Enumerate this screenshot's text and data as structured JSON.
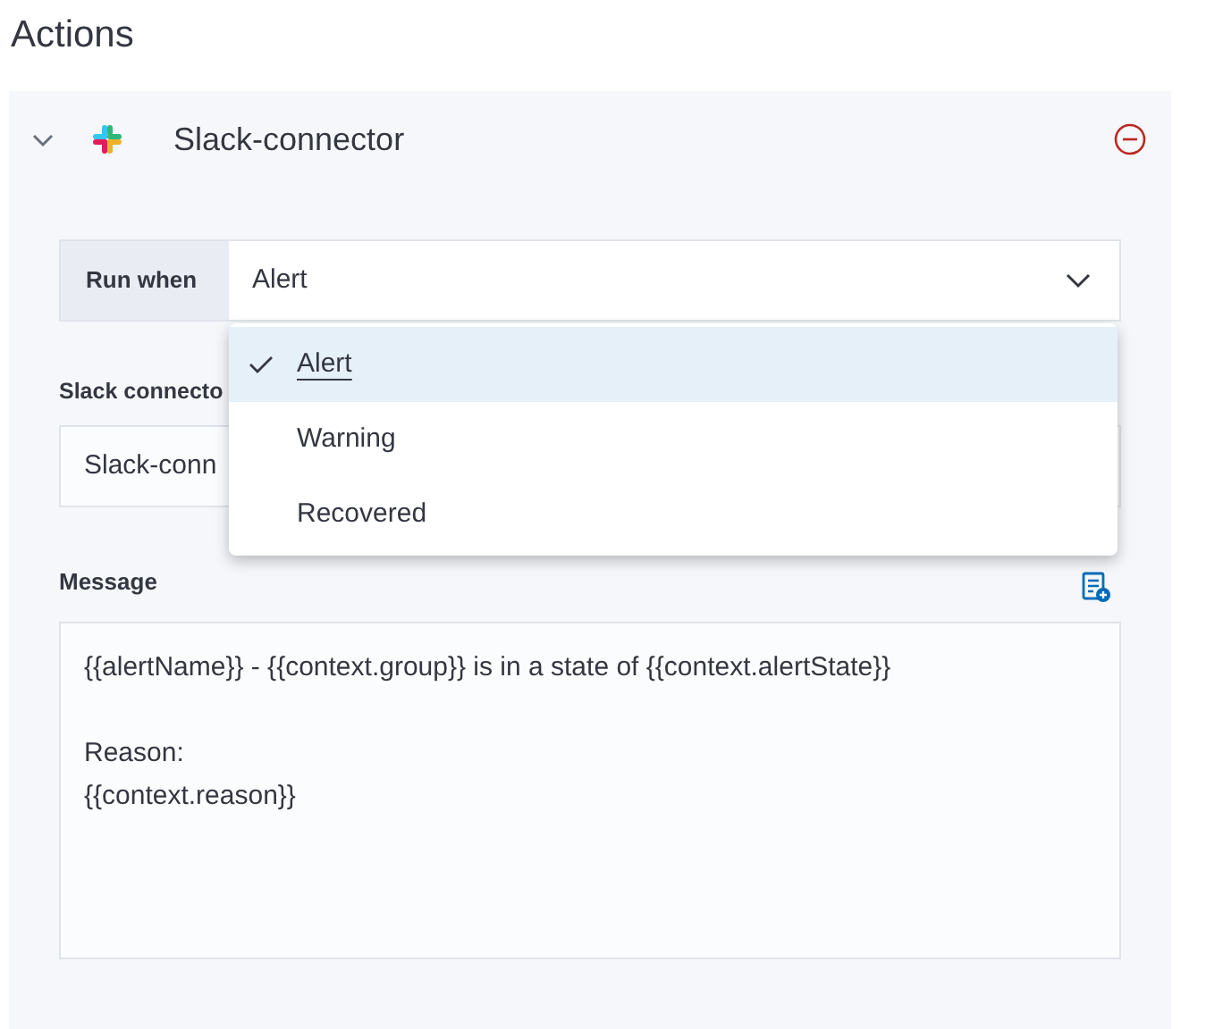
{
  "title": "Actions",
  "action": {
    "connector_name": "Slack-connector",
    "expanded": true,
    "run_when": {
      "label": "Run when",
      "value": "Alert",
      "options": [
        {
          "label": "Alert",
          "selected": true
        },
        {
          "label": "Warning",
          "selected": false
        },
        {
          "label": "Recovered",
          "selected": false
        }
      ]
    },
    "connector_field": {
      "label": "Slack connecto",
      "value": "Slack-conn"
    },
    "message": {
      "label": "Message",
      "value": "{{alertName}} - {{context.group}} is in a state of {{context.alertState}}\n\nReason:\n{{context.reason}}"
    }
  }
}
